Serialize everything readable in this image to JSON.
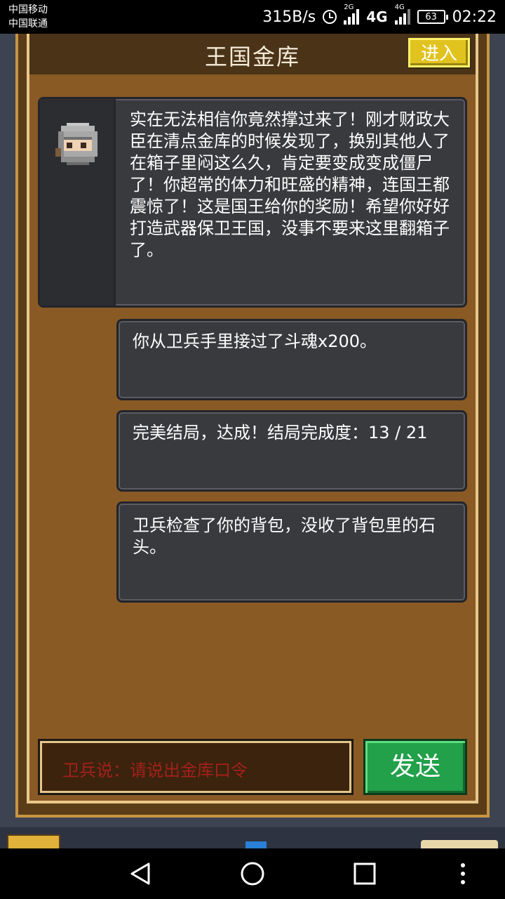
{
  "status_bar": {
    "carrier1": "中国移动",
    "carrier2": "中国联通",
    "net_speed": "315B/s",
    "sig1_label": "2G",
    "net_type": "4G",
    "sig2_label": "4G",
    "battery": "63",
    "time": "02:22"
  },
  "header": {
    "title": "王国金库",
    "enter_label": "进入"
  },
  "dialogue": {
    "speaker_icon": "knight-helmet-icon",
    "message": "实在无法相信你竟然撑过来了！刚才财政大臣在清点金库的时候发现了，换别其他人了在箱子里闷这么久，肯定要变成变成僵尸了！你超常的体力和旺盛的精神，连国王都震惊了！这是国王给你的奖励！希望你好好打造武器保卫王国，没事不要来这里翻箱子了。"
  },
  "events": [
    {
      "text": "你从卫兵手里接过了斗魂x200。"
    },
    {
      "text": "完美结局，达成！结局完成度：13 / 21"
    },
    {
      "text": "卫兵检查了你的背包，没收了背包里的石头。"
    }
  ],
  "input": {
    "placeholder": "卫兵说：请说出金库口令"
  },
  "send_label": "发送",
  "colors": {
    "panel_bg": "#8a5a25",
    "card_bg": "#393a3e",
    "send_green": "#22a04a",
    "enter_yellow": "#e1c320",
    "prompt_red": "#a4201c"
  }
}
